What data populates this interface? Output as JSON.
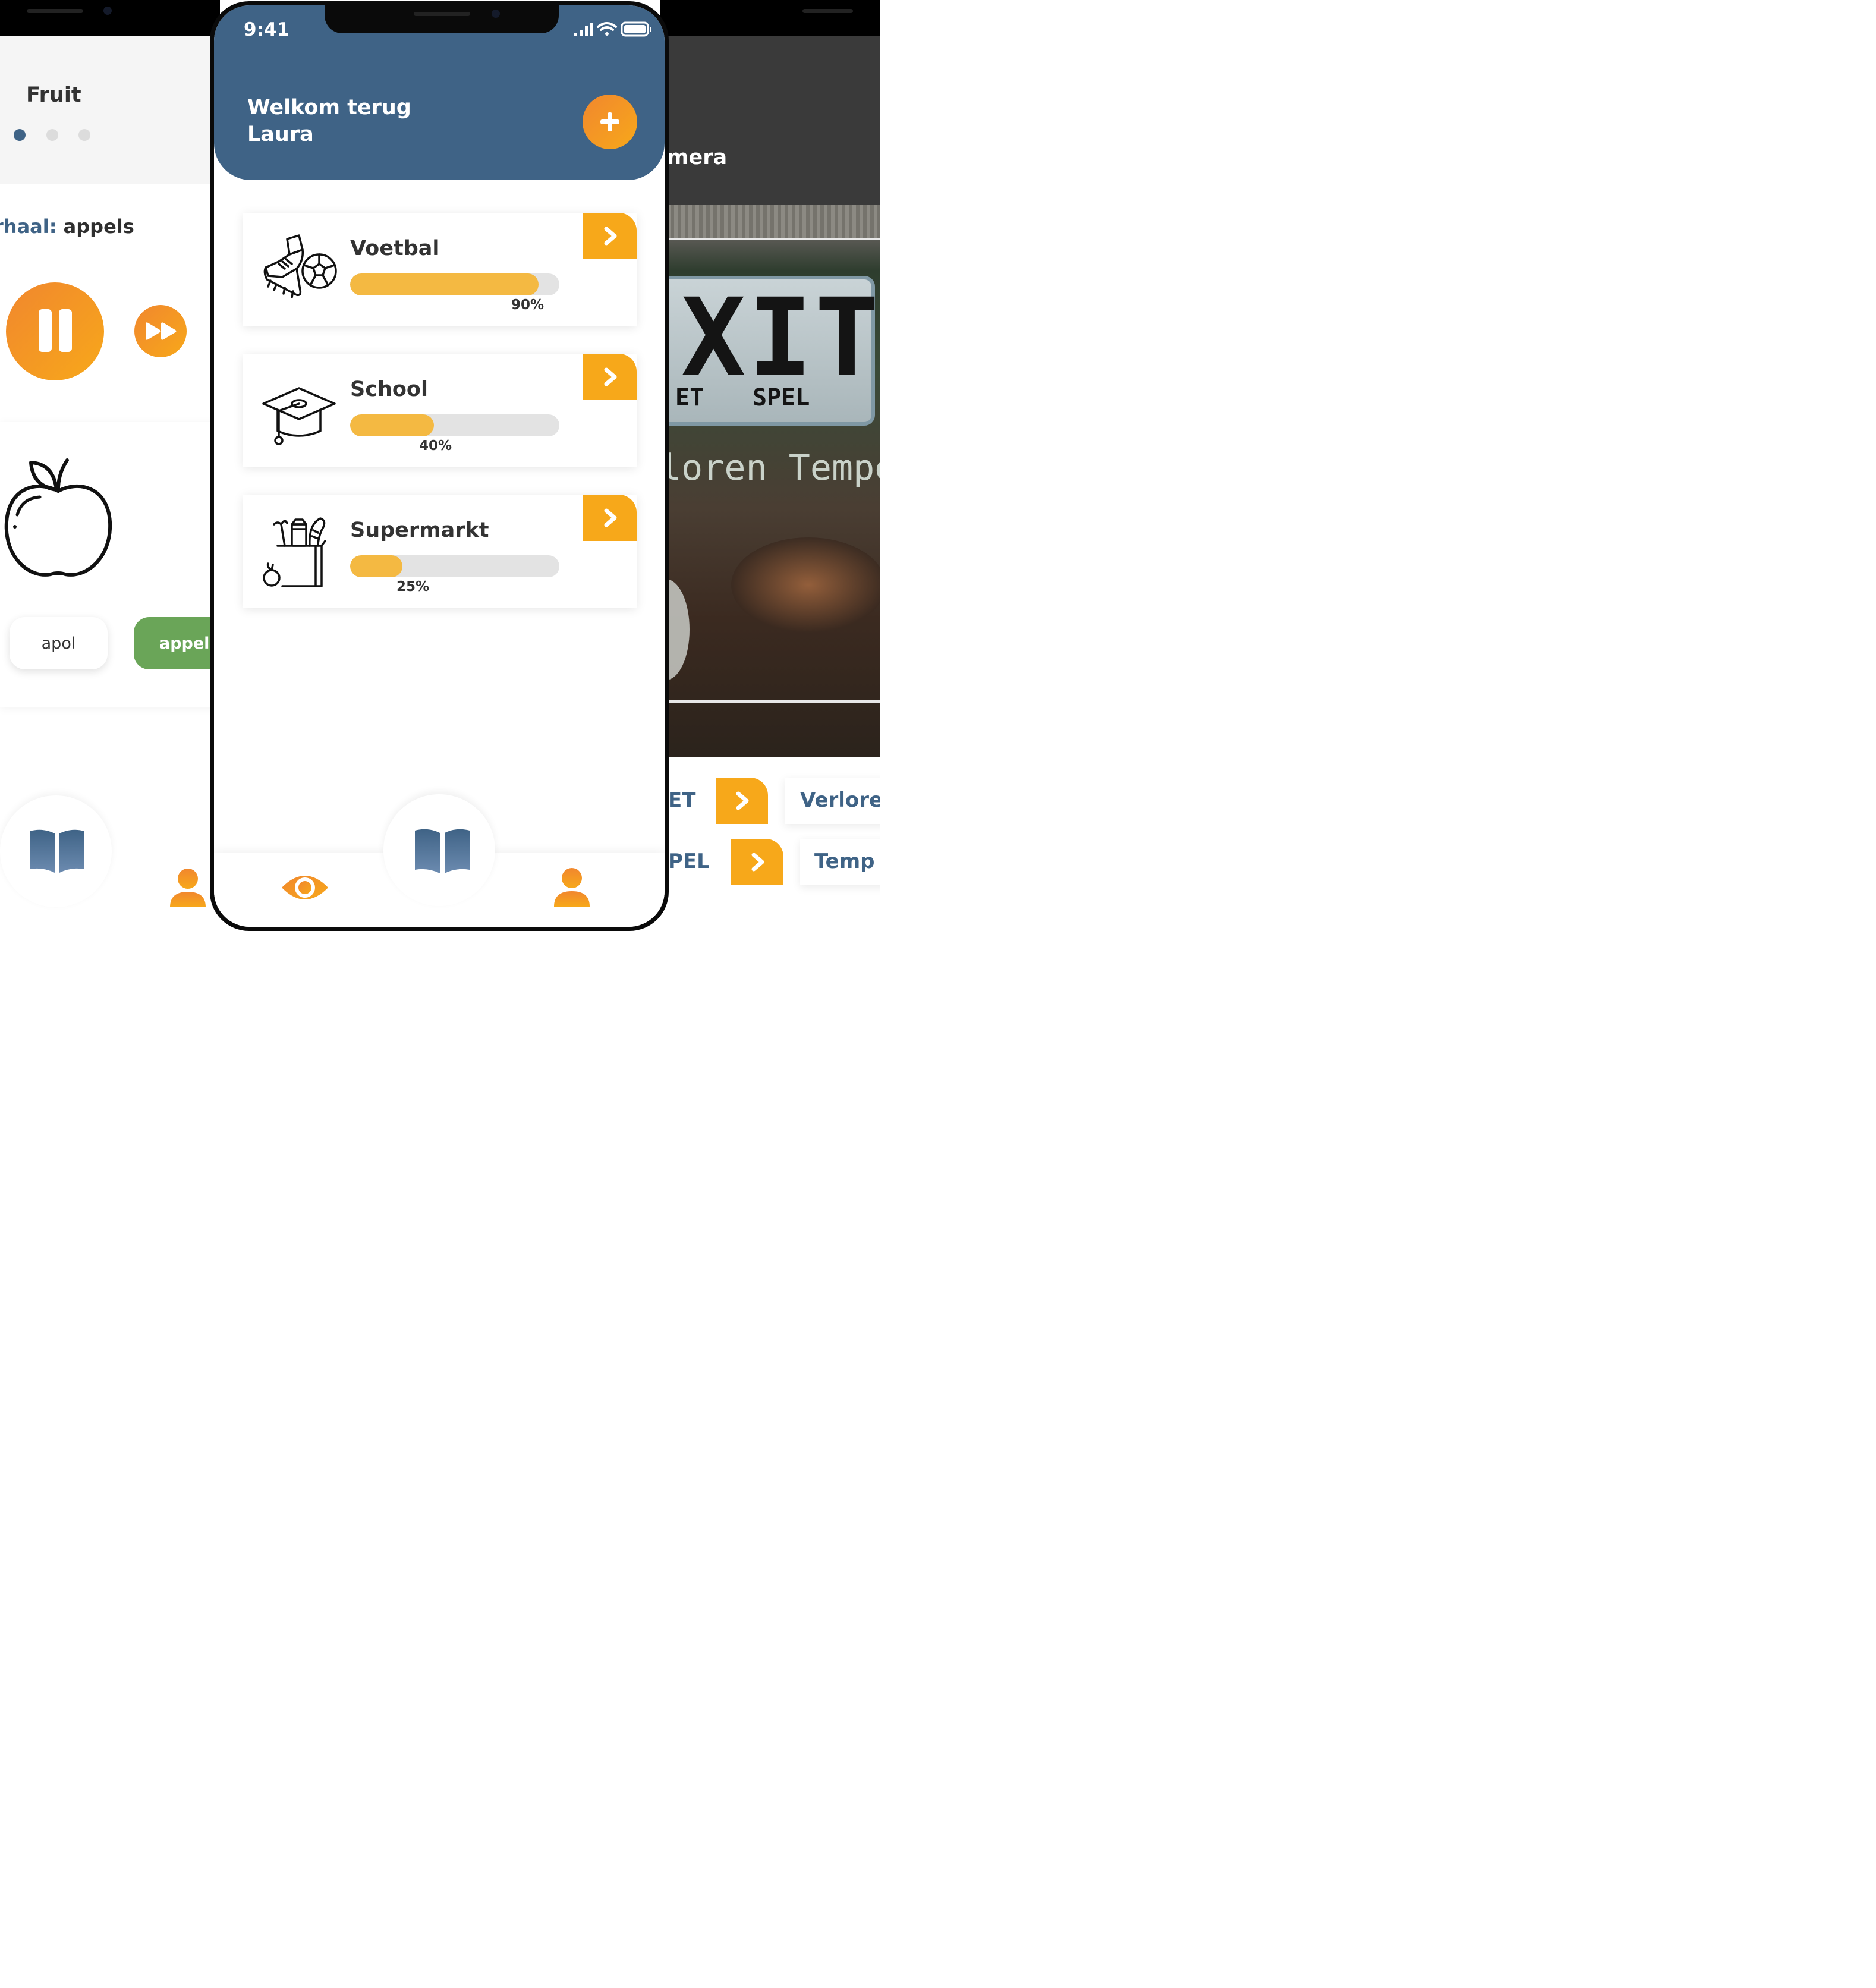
{
  "left_screen": {
    "title": "Fruit",
    "story_prefix": "rhaal:",
    "story_word": "appels",
    "answer_options": [
      "apol",
      "appel"
    ],
    "icons": [
      "pause-icon",
      "fast-forward-icon",
      "apple-icon",
      "book-icon",
      "profile-icon"
    ]
  },
  "center_screen": {
    "status_time": "9:41",
    "welcome_line1": "Welkom terug",
    "welcome_line2": "Laura",
    "categories": [
      {
        "name": "Voetbal",
        "progress": 0.9,
        "progress_label": "90%",
        "icon": "football-boot-icon"
      },
      {
        "name": "School",
        "progress": 0.4,
        "progress_label": "40%",
        "icon": "graduation-cap-icon"
      },
      {
        "name": "Supermarkt",
        "progress": 0.25,
        "progress_label": "25%",
        "icon": "grocery-bag-icon"
      }
    ],
    "tabs": [
      "eye-icon",
      "book-icon",
      "profile-icon"
    ],
    "colors": {
      "primary": "#3f6386",
      "accent": "#f7a81a",
      "progress": "#f4b942"
    }
  },
  "right_screen": {
    "title_partial": "mera",
    "photo_sign_main": "XIT",
    "photo_sign_sub_left": "ET",
    "photo_sign_sub_right": "SPEL",
    "photo_caption": "loren Tempe",
    "list": [
      {
        "tag": "ET",
        "next_label": "Verlore"
      },
      {
        "tag": "PEL",
        "next_label": "Temp"
      }
    ]
  }
}
